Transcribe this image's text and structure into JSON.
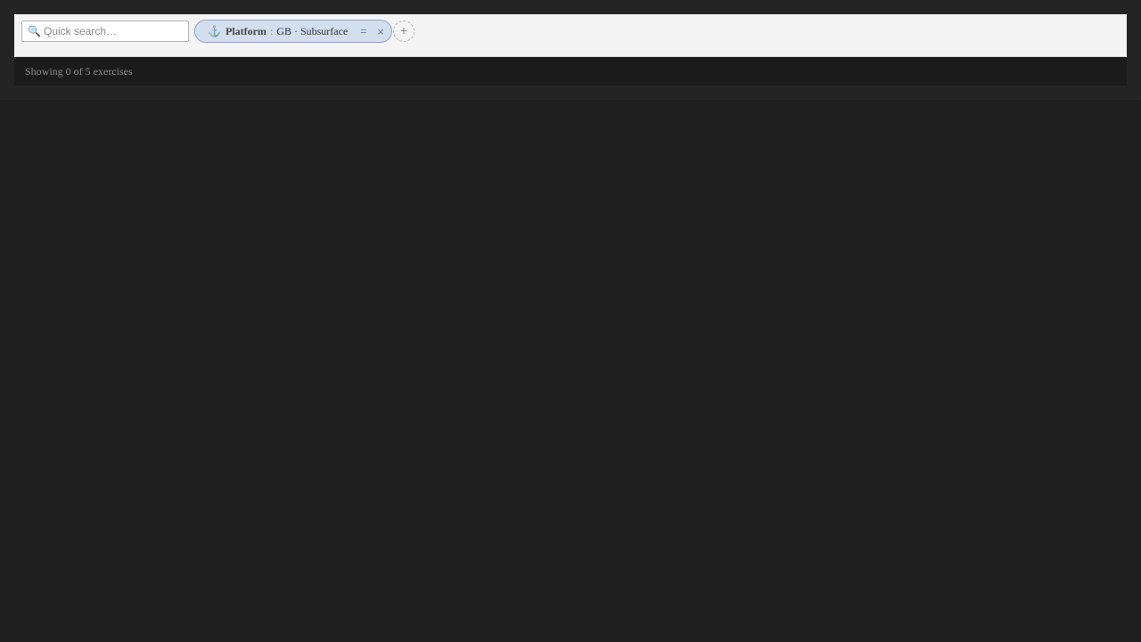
{
  "search": {
    "placeholder": "Quick search…",
    "icon": "search-icon"
  },
  "filters": [
    {
      "icon": "⚓",
      "field": "Platform",
      "separator": ":",
      "value": "GB · Subsurface",
      "operator": "=",
      "remove": "×"
    }
  ],
  "add_filter": {
    "label": "+"
  },
  "status": {
    "text": "Showing 0 of 5 exercises"
  },
  "colors": {
    "chip_background": "#d3deee",
    "chip_border": "#8ea6cc",
    "page_background": "#1e1e1e",
    "bar_background": "#f4f4f4"
  }
}
